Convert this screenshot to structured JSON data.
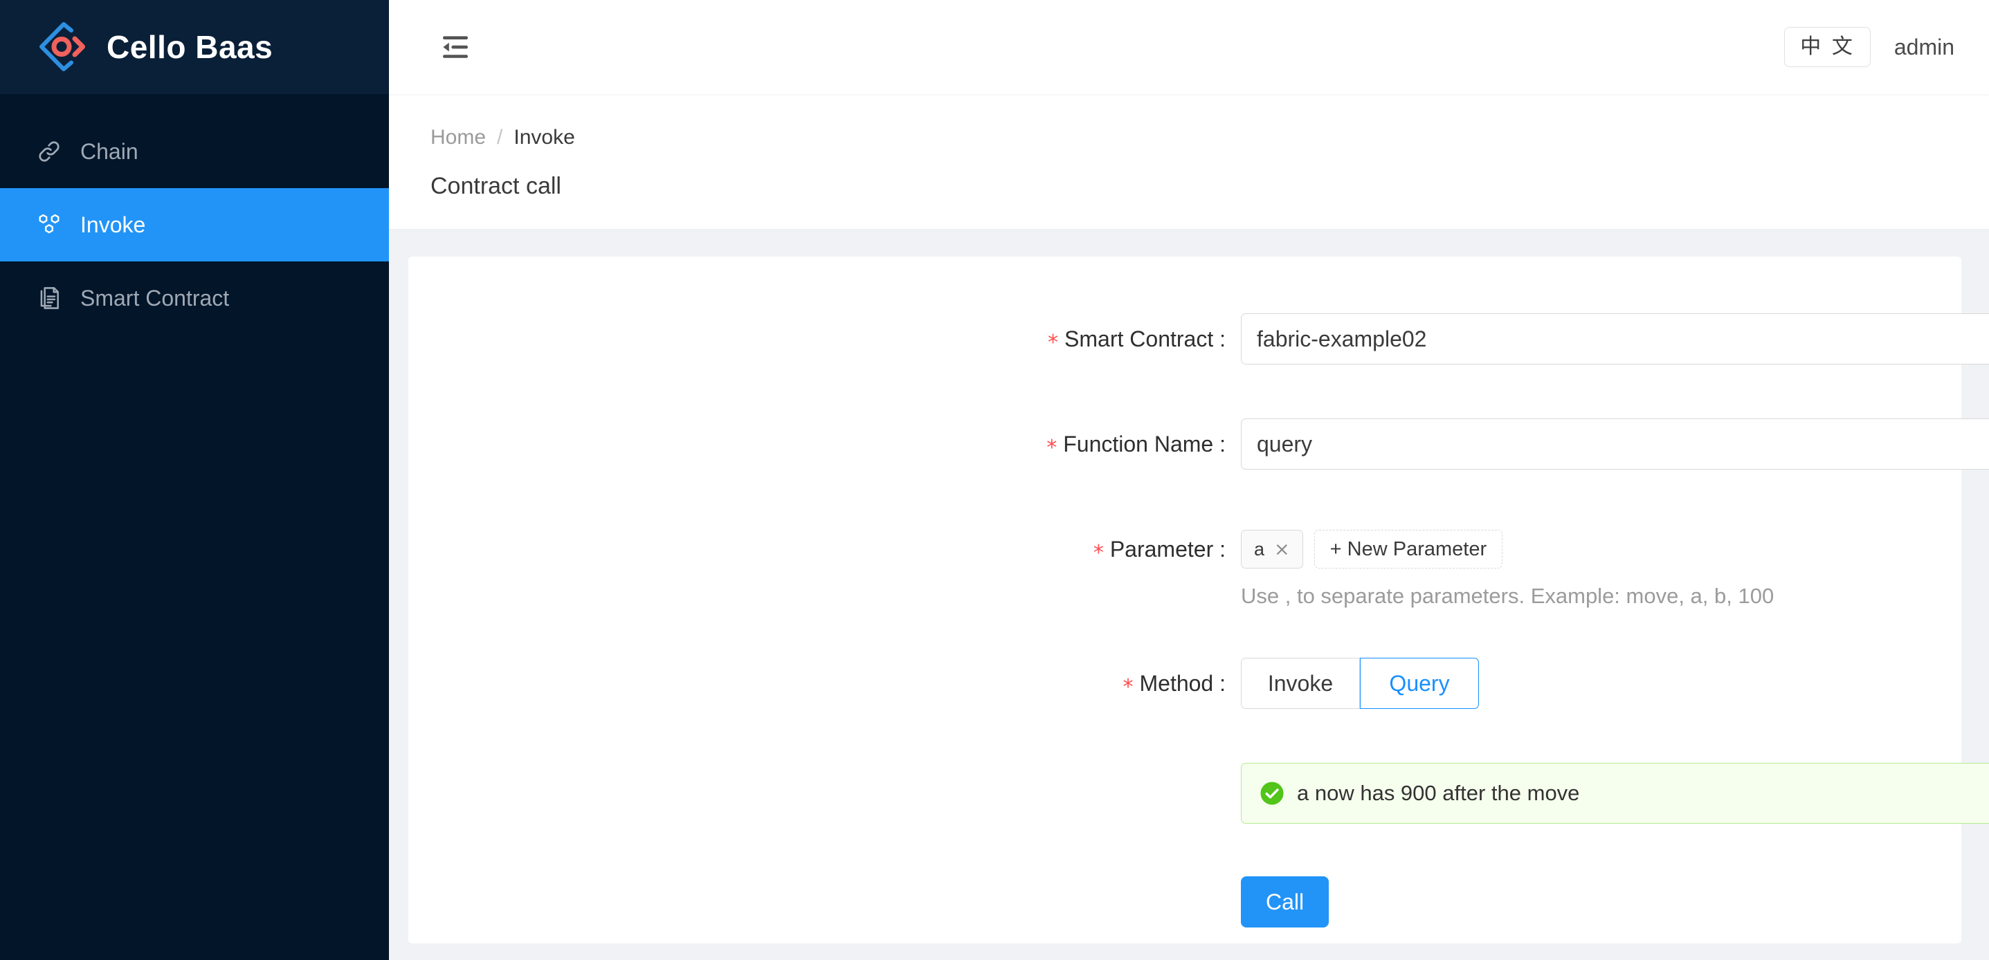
{
  "brand": {
    "name": "Cello Baas",
    "logo_icon": "cello-diamond-logo",
    "accent": "#2294f7",
    "logo_red": "#f1615d"
  },
  "sidebar": {
    "items": [
      {
        "label": "Chain",
        "icon": "link-icon",
        "active": false
      },
      {
        "label": "Invoke",
        "icon": "hexagons-icon",
        "active": true
      },
      {
        "label": "Smart Contract",
        "icon": "documents-icon",
        "active": false
      }
    ]
  },
  "topbar": {
    "fold_icon": "menu-fold-icon",
    "language_label": "中 文",
    "user": "admin"
  },
  "pageheader": {
    "breadcrumb": {
      "home": "Home",
      "separator": "/",
      "current": "Invoke"
    },
    "title": "Contract call"
  },
  "form": {
    "required_marker": "*",
    "smart_contract": {
      "label": "Smart Contract :",
      "value": "fabric-example02",
      "status_icon": "check-circle-icon",
      "dropdown_icon": "chevron-down-icon"
    },
    "function_name": {
      "label": "Function Name :",
      "value": "query",
      "placeholder": "query"
    },
    "parameter": {
      "label": "Parameter :",
      "tags": [
        {
          "text": "a",
          "close": "×"
        }
      ],
      "add_label": "+ New Parameter",
      "hint": "Use , to separate parameters. Example: move, a, b, 100"
    },
    "method": {
      "label": "Method :",
      "options": [
        {
          "label": "Invoke",
          "checked": false
        },
        {
          "label": "Query",
          "checked": true
        }
      ]
    },
    "result_alert": {
      "type": "success",
      "icon": "check-circle-icon",
      "message": "a now has 900 after the move",
      "bg": "#f6ffed",
      "border": "#b7eb8f"
    },
    "submit": {
      "label": "Call"
    }
  }
}
